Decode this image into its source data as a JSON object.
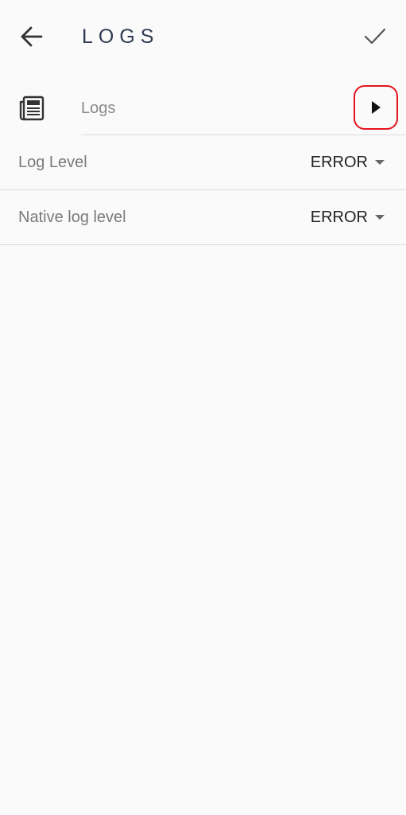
{
  "header": {
    "title": "LOGS",
    "back_icon": "arrow-left-icon",
    "confirm_icon": "check-icon"
  },
  "logs_section": {
    "icon": "newspaper-icon",
    "label": "Logs",
    "action_icon": "play-arrow-icon",
    "highlight_color": "#e4141f"
  },
  "settings": {
    "log_level": {
      "label": "Log Level",
      "value": "ERROR"
    },
    "native_log_level": {
      "label": "Native log level",
      "value": "ERROR"
    }
  }
}
